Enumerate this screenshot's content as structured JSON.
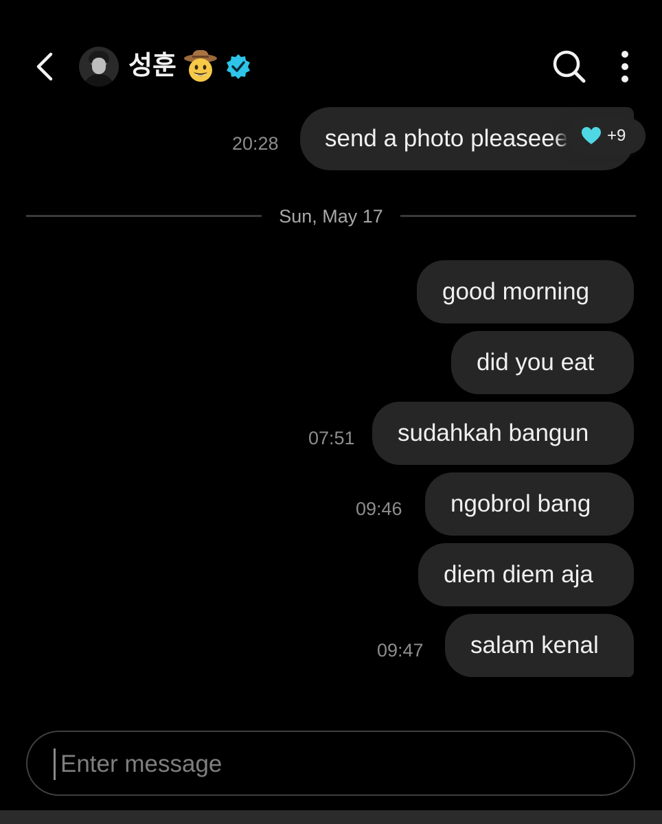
{
  "header": {
    "contact_name": "성훈",
    "emoji_icon": "cowboy-face-emoji",
    "verified_icon": "verified-badge-icon",
    "back_icon": "chevron-left-icon",
    "search_icon": "search-icon",
    "more_icon": "vertical-dots-icon"
  },
  "messages_before": [
    {
      "text": "send a photo pleaseee",
      "time": "20:28",
      "reaction": {
        "icon": "heart-icon",
        "count": "+9",
        "color": "#4fd8e4"
      }
    }
  ],
  "date_separator": "Sun, May 17",
  "messages": [
    {
      "text": "good morning",
      "time": ""
    },
    {
      "text": "did you eat",
      "time": ""
    },
    {
      "text": "sudahkah bangun",
      "time": "07:51"
    },
    {
      "text": "ngobrol bang",
      "time": "09:46"
    },
    {
      "text": "diem diem aja",
      "time": ""
    },
    {
      "text": "salam kenal",
      "time": "09:47"
    }
  ],
  "composer": {
    "placeholder": "Enter message",
    "value": ""
  },
  "colors": {
    "background": "#000000",
    "bubble": "#262626",
    "accent": "#4fd8e4",
    "verified": "#2ec5e8"
  }
}
